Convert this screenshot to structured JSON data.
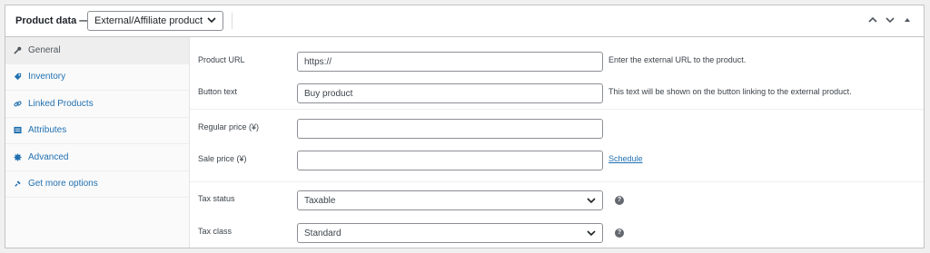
{
  "header": {
    "title": "Product data —",
    "product_type": "External/Affiliate product"
  },
  "tabs": [
    {
      "label": "General",
      "icon": "wrench-icon",
      "active": true
    },
    {
      "label": "Inventory",
      "icon": "tag-icon"
    },
    {
      "label": "Linked Products",
      "icon": "link-icon"
    },
    {
      "label": "Attributes",
      "icon": "list-icon"
    },
    {
      "label": "Advanced",
      "icon": "gear-icon"
    },
    {
      "label": "Get more options",
      "icon": "plug-icon"
    }
  ],
  "general": {
    "product_url": {
      "label": "Product URL",
      "value": "https://",
      "desc": "Enter the external URL to the product."
    },
    "button_text": {
      "label": "Button text",
      "value": "Buy product",
      "desc": "This text will be shown on the button linking to the external product."
    },
    "regular_price": {
      "label": "Regular price (¥)",
      "value": ""
    },
    "sale_price": {
      "label": "Sale price (¥)",
      "value": "",
      "schedule_link": "Schedule"
    },
    "tax_status": {
      "label": "Tax status",
      "value": "Taxable"
    },
    "tax_class": {
      "label": "Tax class",
      "value": "Standard"
    }
  },
  "colors": {
    "link": "#2271b1",
    "border": "#c3c4c7",
    "text": "#1d2327"
  }
}
